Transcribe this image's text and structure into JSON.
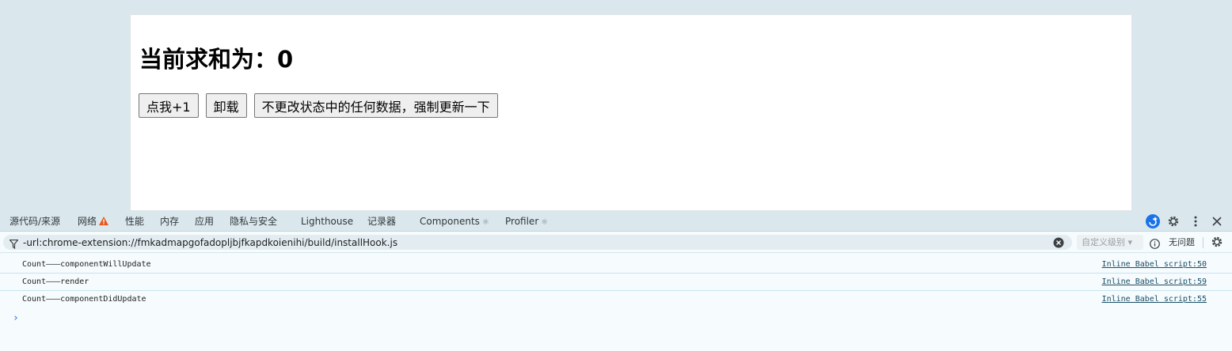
{
  "app": {
    "heading": "当前求和为：0",
    "buttons": {
      "increment": "点我+1",
      "unmount": "卸载",
      "force_update": "不更改状态中的任何数据，强制更新一下"
    }
  },
  "devtools": {
    "tabs": {
      "sources": "源代码/来源",
      "network": "网络",
      "performance": "性能",
      "memory": "内存",
      "application": "应用",
      "privacy": "隐私与安全",
      "lighthouse": "Lighthouse",
      "recorder": "记录器",
      "components": "Components",
      "profiler": "Profiler"
    },
    "react_glyph": "⚛",
    "icons": {
      "warning": "warning-triangle-icon",
      "ai_assist": "ai-assist-icon",
      "settings": "gear-icon",
      "more": "more-vertical-icon",
      "close": "close-icon",
      "filter": "filter-icon",
      "clear": "clear-circle-icon",
      "info": "info-icon"
    },
    "colors": {
      "warning": "#e8561a",
      "ai_badge": "#1a73e8",
      "link": "#1a4f66"
    },
    "filter": {
      "value": "-url:chrome-extension://fmkadmapgofadopljbjfkapdkoienihi/build/installHook.js"
    },
    "level_select": "自定义级别 ▾",
    "issues_label": "无问题",
    "console": {
      "rows": [
        {
          "message": "Count———componentWillUpdate",
          "source": "Inline Babel script:50"
        },
        {
          "message": "Count———render",
          "source": "Inline Babel script:59"
        },
        {
          "message": "Count———componentDidUpdate",
          "source": "Inline Babel script:55"
        }
      ],
      "prompt": "›"
    }
  }
}
